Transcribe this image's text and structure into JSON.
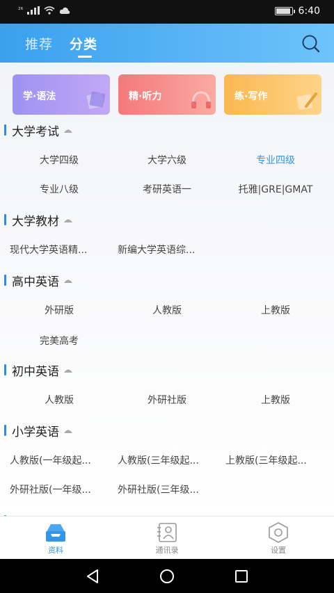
{
  "status_bar": {
    "network": "²⁶",
    "time": "6:40",
    "battery_level": 0.85
  },
  "header": {
    "tabs": [
      {
        "label": "推荐",
        "active": false
      },
      {
        "label": "分类",
        "active": true
      }
    ],
    "icons": {
      "search": "search-icon"
    }
  },
  "feature_cards": [
    {
      "label": "学·语法",
      "icon": "book-icon",
      "color": "#a89bf3"
    },
    {
      "label": "精·听力",
      "icon": "headphones-icon",
      "color": "#f58a86"
    },
    {
      "label": "练·写作",
      "icon": "pen-paper-icon",
      "color": "#fcc468"
    }
  ],
  "sections": [
    {
      "title": "大学考试",
      "items": [
        "大学四级",
        "大学六级",
        "专业四级",
        "专业八级",
        "考研英语一",
        "托雅|GRE|GMAT"
      ],
      "active_item": "专业四级"
    },
    {
      "title": "大学教材",
      "items": [
        "现代大学英语精...",
        "新编大学英语综..."
      ]
    },
    {
      "title": "高中英语",
      "items": [
        "外研版",
        "人教版",
        "上教版",
        "完美高考"
      ]
    },
    {
      "title": "初中英语",
      "items": [
        "人教版",
        "外研社版",
        "上教版"
      ]
    },
    {
      "title": "小学英语",
      "items": [
        "人教版(一年级起...",
        "人教版(三年级起...",
        "上教版(三年级起...",
        "外研社版(一年级...",
        "外研社版(三年级..."
      ]
    }
  ],
  "bottom_nav": [
    {
      "label": "资料",
      "icon": "inbox-icon",
      "active": true
    },
    {
      "label": "通讯录",
      "icon": "contacts-icon",
      "active": false
    },
    {
      "label": "设置",
      "icon": "hexagon-settings-icon",
      "active": false
    }
  ],
  "colors": {
    "accent": "#3196e8",
    "header_start": "#3aa0ee",
    "header_end": "#6ec3fa"
  }
}
